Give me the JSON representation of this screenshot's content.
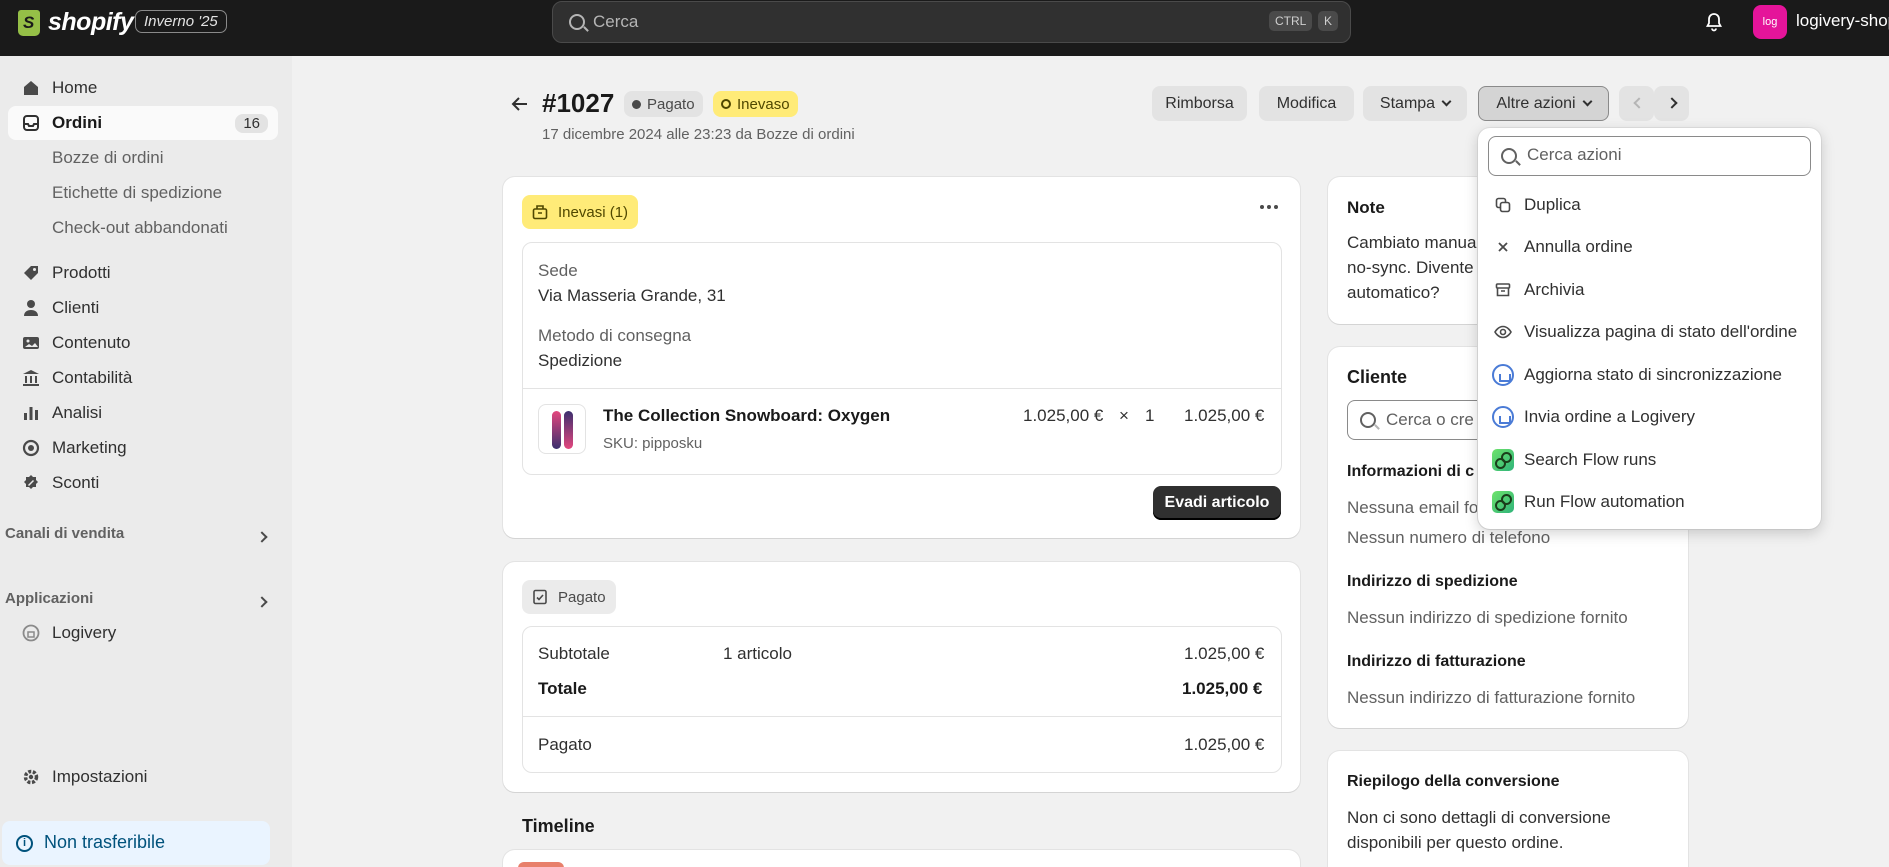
{
  "topbar": {
    "logo_text": "shopify",
    "edition": "Inverno '25",
    "search_placeholder": "Cerca",
    "kbd_ctrl": "CTRL",
    "kbd_k": "K",
    "avatar_text": "log",
    "shop_name": "logivery-shop"
  },
  "sidebar": {
    "home": "Home",
    "orders": "Ordini",
    "orders_count": "16",
    "drafts": "Bozze di ordini",
    "labels": "Etichette di spedizione",
    "abandoned": "Check-out abbandonati",
    "products": "Prodotti",
    "customers": "Clienti",
    "content": "Contenuto",
    "accounting": "Contabilità",
    "analytics": "Analisi",
    "marketing": "Marketing",
    "discounts": "Sconti",
    "sales_channels": "Canali di vendita",
    "apps": "Applicazioni",
    "logivery": "Logivery",
    "settings": "Impostazioni",
    "non_transferable": "Non trasferibile"
  },
  "header": {
    "order_number": "#1027",
    "badge_paid": "Pagato",
    "badge_unfulfilled": "Inevaso",
    "subtitle": "17 dicembre 2024 alle 23:23 da Bozze di ordini",
    "refund": "Rimborsa",
    "edit": "Modifica",
    "print": "Stampa",
    "more_actions": "Altre azioni"
  },
  "fulfillment": {
    "tag": "Inevasi (1)",
    "location_label": "Sede",
    "location_value": "Via Masseria Grande, 31",
    "delivery_label": "Metodo di consegna",
    "delivery_value": "Spedizione",
    "product_name": "The Collection Snowboard: Oxygen",
    "sku": "SKU: pipposku",
    "unit_price": "1.025,00 €",
    "times": "×",
    "qty": "1",
    "line_total": "1.025,00 €",
    "fulfill_button": "Evadi articolo"
  },
  "payment": {
    "tag": "Pagato",
    "subtotal_label": "Subtotale",
    "subtotal_items": "1 articolo",
    "subtotal_value": "1.025,00 €",
    "total_label": "Totale",
    "total_value": "1.025,00 €",
    "paid_label": "Pagato",
    "paid_value": "1.025,00 €"
  },
  "timeline_title": "Timeline",
  "notes": {
    "title": "Note",
    "line1": "Cambiato manua",
    "line2": "no-sync. Divente",
    "line3": "automatico?"
  },
  "customer": {
    "title": "Cliente",
    "search_placeholder": "Cerca o cre",
    "contact_title": "Informazioni di c",
    "no_email": "Nessuna email fo",
    "no_phone": "Nessun numero di telefono",
    "shipping_title": "Indirizzo di spedizione",
    "shipping_value": "Nessun indirizzo di spedizione fornito",
    "billing_title": "Indirizzo di fatturazione",
    "billing_value": "Nessun indirizzo di fatturazione fornito"
  },
  "conversion": {
    "title": "Riepilogo della conversione",
    "line1": "Non ci sono dettagli di conversione",
    "line2": "disponibili per questo ordine."
  },
  "dropdown": {
    "search_placeholder": "Cerca azioni",
    "items": [
      {
        "label": "Duplica",
        "icon": "duplicate-icon"
      },
      {
        "label": "Annulla ordine",
        "icon": "close-icon"
      },
      {
        "label": "Archivia",
        "icon": "archive-icon"
      },
      {
        "label": "Visualizza pagina di stato dell'ordine",
        "icon": "eye-icon"
      },
      {
        "label": "Aggiorna stato di sincronizzazione",
        "icon": "logivery-icon"
      },
      {
        "label": "Invia ordine a Logivery",
        "icon": "logivery-icon"
      },
      {
        "label": "Search Flow runs",
        "icon": "flow-icon"
      },
      {
        "label": "Run Flow automation",
        "icon": "flow-icon"
      }
    ]
  },
  "colors": {
    "topbar": "#1a1a1a",
    "unfulfilled_badge": "#ffeb78",
    "brand_green": "#95bf47",
    "avatar": "#e5149a"
  }
}
